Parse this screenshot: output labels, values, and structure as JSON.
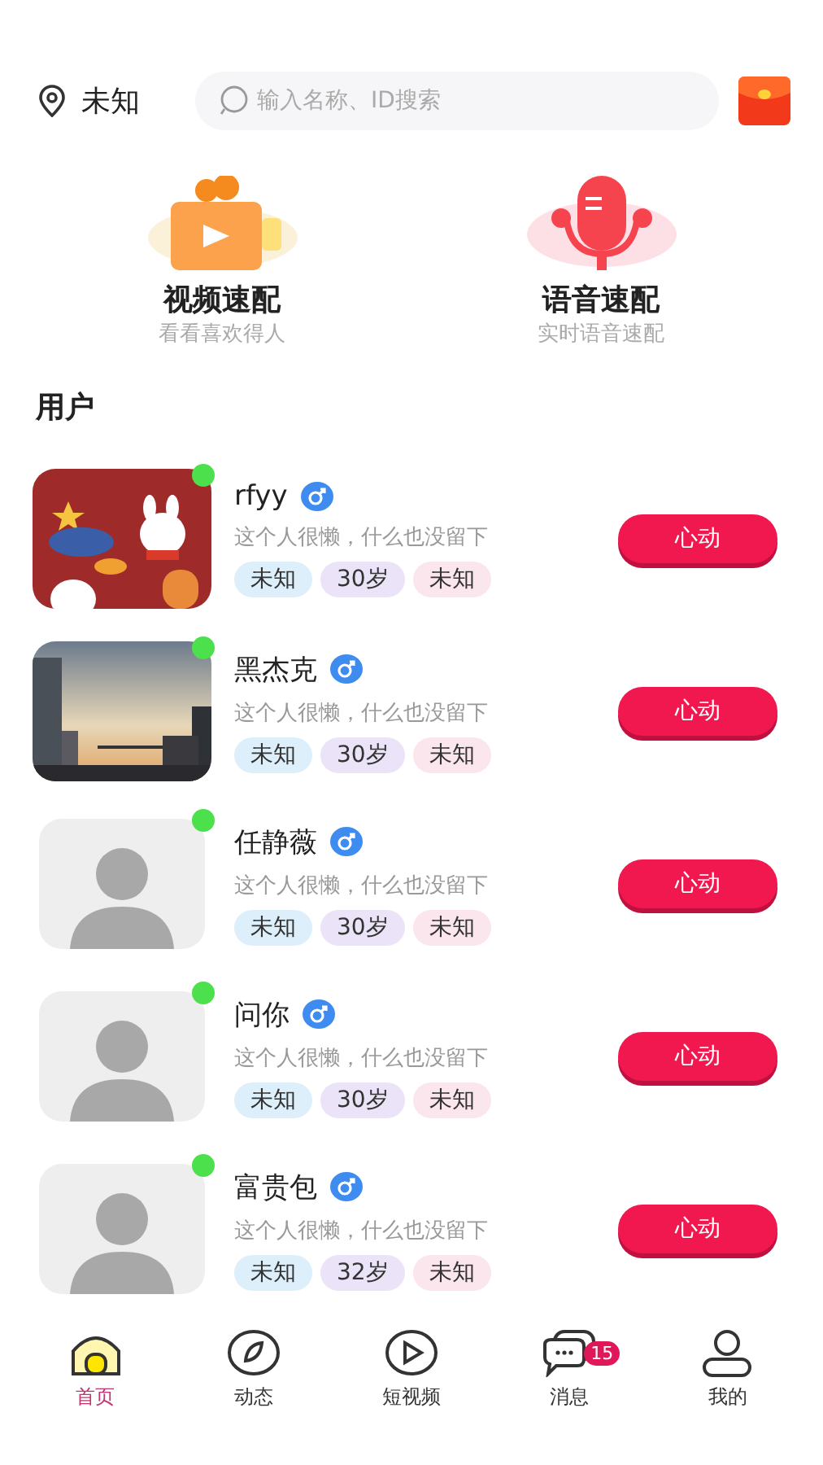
{
  "location": "未知",
  "search": {
    "placeholder": "输入名称、ID搜索"
  },
  "features": [
    {
      "kind": "video",
      "title": "视频速配",
      "subtitle": "看看喜欢得人"
    },
    {
      "kind": "voice",
      "title": "语音速配",
      "subtitle": "实时语音速配"
    }
  ],
  "section_title": "用户",
  "users": [
    {
      "name": "rfyy",
      "kind": "illustration",
      "online": true,
      "bio": "这个人很懒，什么也没留下",
      "tags": [
        "未知",
        "30岁",
        "未知"
      ],
      "action": "心动"
    },
    {
      "name": "黑杰克",
      "online": true,
      "bio": "这个人很懒，什么也没留下",
      "tags": [
        "未知",
        "30岁",
        "未知"
      ],
      "action": "心动"
    },
    {
      "name": "任静薇",
      "kind": "placeholder",
      "online": true,
      "bio": "这个人很懒，什么也没留下",
      "tags": [
        "未知",
        "30岁",
        "未知"
      ],
      "action": "心动"
    },
    {
      "name": "问你",
      "kind": "placeholder",
      "online": true,
      "bio": "这个人很懒，什么也没留下",
      "tags": [
        "未知",
        "30岁",
        "未知"
      ],
      "action": "心动"
    },
    {
      "name": "富贵包",
      "kind": "placeholder",
      "online": true,
      "bio": "这个人很懒，什么也没留下",
      "tags": [
        "未知",
        "32岁",
        "未知"
      ],
      "action": "心动"
    }
  ],
  "tabs": [
    {
      "kind": "home",
      "label": "首页",
      "selected": true
    },
    {
      "kind": "compass",
      "label": "动态",
      "selected": false
    },
    {
      "kind": "play",
      "label": "短视频",
      "selected": false
    },
    {
      "kind": "chat",
      "label": "消息",
      "selected": false,
      "badge": "15"
    },
    {
      "kind": "person",
      "label": "我的",
      "selected": false
    }
  ]
}
